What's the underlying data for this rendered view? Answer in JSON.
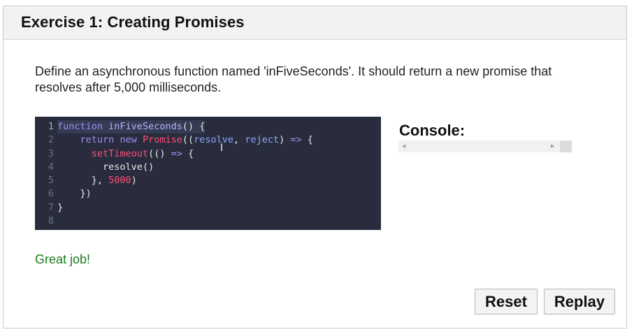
{
  "exercise": {
    "title": "Exercise 1: Creating Promises",
    "description": "Define an asynchronous function named 'inFiveSeconds'. It should return a new promise that resolves after 5,000 milliseconds."
  },
  "editor": {
    "line_numbers": [
      "1",
      "2",
      "3",
      "4",
      "5",
      "6",
      "7",
      "8"
    ],
    "active_line": 1,
    "lines": [
      [
        {
          "t": "function",
          "c": "kw"
        },
        {
          "t": " ",
          "c": "pun"
        },
        {
          "t": "inFiveSeconds",
          "c": "fn"
        },
        {
          "t": "() {",
          "c": "pun"
        }
      ],
      [
        {
          "t": "    ",
          "c": "pun"
        },
        {
          "t": "return",
          "c": "kw"
        },
        {
          "t": " ",
          "c": "pun"
        },
        {
          "t": "new",
          "c": "kw"
        },
        {
          "t": " ",
          "c": "pun"
        },
        {
          "t": "Promise",
          "c": "str"
        },
        {
          "t": "((",
          "c": "pun"
        },
        {
          "t": "resolve",
          "c": "prm"
        },
        {
          "t": ", ",
          "c": "pun"
        },
        {
          "t": "reject",
          "c": "prm"
        },
        {
          "t": ") ",
          "c": "pun"
        },
        {
          "t": "=>",
          "c": "kw"
        },
        {
          "t": " {",
          "c": "pun"
        }
      ],
      [
        {
          "t": "      ",
          "c": "pun"
        },
        {
          "t": "setTimeout",
          "c": "str"
        },
        {
          "t": "(() ",
          "c": "pun"
        },
        {
          "t": "=>",
          "c": "kw"
        },
        {
          "t": " {",
          "c": "pun"
        }
      ],
      [
        {
          "t": "        ",
          "c": "pun"
        },
        {
          "t": "resolve",
          "c": "pun"
        },
        {
          "t": "()",
          "c": "pun"
        }
      ],
      [
        {
          "t": "      ",
          "c": "pun"
        },
        {
          "t": "}, ",
          "c": "pun"
        },
        {
          "t": "5000",
          "c": "num"
        },
        {
          "t": ")",
          "c": "pun"
        }
      ],
      [
        {
          "t": "    ",
          "c": "pun"
        },
        {
          "t": "})",
          "c": "pun"
        }
      ],
      [
        {
          "t": "}",
          "c": "pun"
        }
      ],
      [
        {
          "t": "",
          "c": "pun"
        }
      ]
    ]
  },
  "console": {
    "title": "Console:",
    "scroll_left_icon": "triangle-left",
    "scroll_right_icon": "triangle-right"
  },
  "status": {
    "message": "Great job!",
    "color": "#1a7a1a"
  },
  "buttons": {
    "reset_label": "Reset",
    "replay_label": "Replay"
  }
}
